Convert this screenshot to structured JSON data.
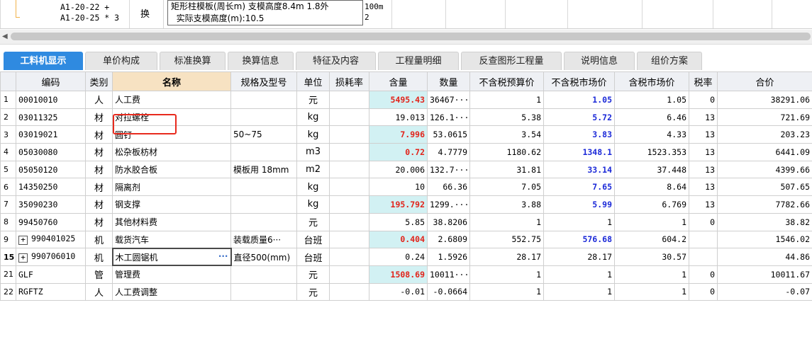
{
  "top_row": {
    "code_lines": [
      "A1-20-22 +",
      "A1-20-25 * 3"
    ],
    "type": "换",
    "desc_lines": [
      "矩形柱模板(周长m) 支模高度8.4m 1.8外",
      "  实际支模高度(m):10.5"
    ],
    "qty_lines": [
      "100m",
      "2"
    ]
  },
  "tabs": [
    {
      "label": "工料机显示"
    },
    {
      "label": "单价构成"
    },
    {
      "label": "标准换算"
    },
    {
      "label": "换算信息"
    },
    {
      "label": "特征及内容"
    },
    {
      "label": "工程量明细"
    },
    {
      "label": "反查图形工程量"
    },
    {
      "label": "说明信息"
    },
    {
      "label": "组价方案"
    }
  ],
  "columns": [
    "编码",
    "类别",
    "名称",
    "规格及型号",
    "单位",
    "损耗率",
    "含量",
    "数量",
    "不含税预算价",
    "不含税市场价",
    "含税市场价",
    "税率",
    "合价"
  ],
  "rows": [
    {
      "n": "1",
      "code": "00010010",
      "cat": "人",
      "name": "人工费",
      "spec": "",
      "unit": "元",
      "loss": "",
      "content": "5495.43",
      "qty": "36467···",
      "pre_budget": "1",
      "pre_market": "1.05",
      "tax_market": "1.05",
      "rate": "0",
      "total": "38291.06"
    },
    {
      "n": "2",
      "code": "03011325",
      "cat": "材",
      "name": "对拉螺栓",
      "spec": "",
      "unit": "kg",
      "loss": "",
      "content": "19.013",
      "qty": "126.1···",
      "pre_budget": "5.38",
      "pre_market": "5.72",
      "tax_market": "6.46",
      "rate": "13",
      "total": "721.69"
    },
    {
      "n": "3",
      "code": "03019021",
      "cat": "材",
      "name": "圆钉",
      "spec": "50~75",
      "unit": "kg",
      "loss": "",
      "content": "7.996",
      "qty": "53.0615",
      "pre_budget": "3.54",
      "pre_market": "3.83",
      "tax_market": "4.33",
      "rate": "13",
      "total": "203.23"
    },
    {
      "n": "4",
      "code": "05030080",
      "cat": "材",
      "name": "松杂板枋材",
      "spec": "",
      "unit": "m3",
      "loss": "",
      "content": "0.72",
      "qty": "4.7779",
      "pre_budget": "1180.62",
      "pre_market": "1348.1",
      "tax_market": "1523.353",
      "rate": "13",
      "total": "6441.09"
    },
    {
      "n": "5",
      "code": "05050120",
      "cat": "材",
      "name": "防水胶合板",
      "spec": "模板用 18mm",
      "unit": "m2",
      "loss": "",
      "content": "20.006",
      "qty": "132.7···",
      "pre_budget": "31.81",
      "pre_market": "33.14",
      "tax_market": "37.448",
      "rate": "13",
      "total": "4399.66"
    },
    {
      "n": "6",
      "code": "14350250",
      "cat": "材",
      "name": "隔离剂",
      "spec": "",
      "unit": "kg",
      "loss": "",
      "content": "10",
      "qty": "66.36",
      "pre_budget": "7.05",
      "pre_market": "7.65",
      "tax_market": "8.64",
      "rate": "13",
      "total": "507.65"
    },
    {
      "n": "7",
      "code": "35090230",
      "cat": "材",
      "name": "钢支撑",
      "spec": "",
      "unit": "kg",
      "loss": "",
      "content": "195.792",
      "qty": "1299.···",
      "pre_budget": "3.88",
      "pre_market": "5.99",
      "tax_market": "6.769",
      "rate": "13",
      "total": "7782.66"
    },
    {
      "n": "8",
      "code": "99450760",
      "cat": "材",
      "name": "其他材料费",
      "spec": "",
      "unit": "元",
      "loss": "",
      "content": "5.85",
      "qty": "38.8206",
      "pre_budget": "1",
      "pre_market": "1",
      "tax_market": "1",
      "rate": "0",
      "total": "38.82"
    },
    {
      "n": "9",
      "code": "990401025",
      "cat": "机",
      "name": "载货汽车",
      "spec": "装载质量6···",
      "unit": "台班",
      "loss": "",
      "content": "0.404",
      "qty": "2.6809",
      "pre_budget": "552.75",
      "pre_market": "576.68",
      "tax_market": "604.2",
      "rate": "",
      "total": "1546.02"
    },
    {
      "n": "15",
      "code": "990706010",
      "cat": "机",
      "name": "木工圆锯机",
      "spec": "直径500(mm)",
      "unit": "台班",
      "loss": "",
      "content": "0.24",
      "qty": "1.5926",
      "pre_budget": "28.17",
      "pre_market": "28.17",
      "tax_market": "30.57",
      "rate": "",
      "total": "44.86"
    },
    {
      "n": "21",
      "code": "GLF",
      "cat": "管",
      "name": "管理费",
      "spec": "",
      "unit": "元",
      "loss": "",
      "content": "1508.69",
      "qty": "10011···",
      "pre_budget": "1",
      "pre_market": "1",
      "tax_market": "1",
      "rate": "0",
      "total": "10011.67"
    },
    {
      "n": "22",
      "code": "RGFTZ",
      "cat": "人",
      "name": "人工费调整",
      "spec": "",
      "unit": "元",
      "loss": "",
      "content": "-0.01",
      "qty": "-0.0664",
      "pre_budget": "1",
      "pre_market": "1",
      "tax_market": "1",
      "rate": "0",
      "total": "-0.07"
    }
  ],
  "selected_cell_dots": "···",
  "expander_symbol": "+",
  "colors": {
    "accent_tab": "#2f8ae0",
    "red_value": "#e2231a",
    "blue_value": "#1c2ad8",
    "highlight": "#e82a1e"
  }
}
